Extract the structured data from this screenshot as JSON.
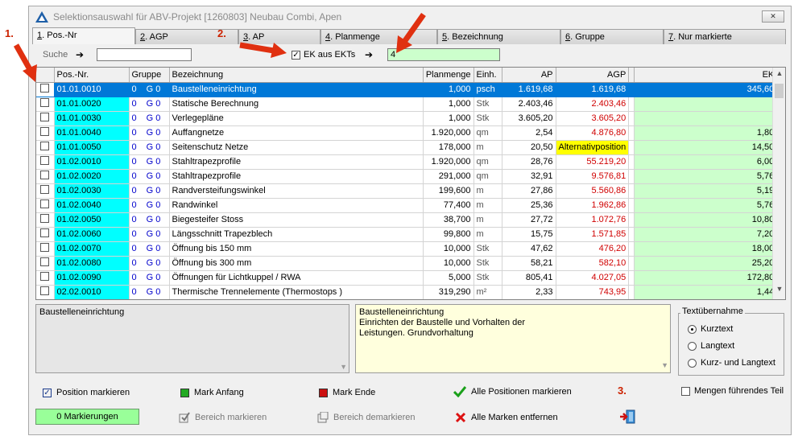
{
  "window": {
    "title": "Selektionsauswahl für ABV-Projekt [1260803] Neubau Combi, Apen",
    "close_symbol": "✕"
  },
  "tabs": [
    {
      "key": "1",
      "label": ". Pos.-Nr"
    },
    {
      "key": "2",
      "label": ". AGP"
    },
    {
      "key": "3",
      "label": ". AP"
    },
    {
      "key": "4",
      "label": ". Planmenge"
    },
    {
      "key": "5",
      "label": ". Bezeichnung"
    },
    {
      "key": "6",
      "label": ". Gruppe"
    },
    {
      "key": "7",
      "label": ". Nur markierte"
    }
  ],
  "search": {
    "label": "Suche",
    "arrow": "➔",
    "value": ""
  },
  "ek_filter": {
    "label": "EK aus EKTs",
    "checked": true,
    "arrow": "➔",
    "value": "4"
  },
  "columns": {
    "pos": "Pos.-Nr.",
    "group": "Gruppe",
    "name": "Bezeichnung",
    "qty": "Planmenge",
    "unit": "Einh.",
    "ap": "AP",
    "agp": "AGP",
    "ek": "EK"
  },
  "rows": [
    {
      "pos": "01.01.0010",
      "g1": "0",
      "g2": "G 0",
      "name": "Baustelleneinrichtung",
      "qty": "1,000",
      "unit": "psch",
      "ap": "1.619,68",
      "agp": "1.619,68",
      "ek": "345,60",
      "selected": true
    },
    {
      "pos": "01.01.0020",
      "g1": "0",
      "g2": "G 0",
      "name": "Statische Berechnung",
      "qty": "1,000",
      "unit": "Stk",
      "ap": "2.403,46",
      "agp": "2.403,46",
      "ek": ""
    },
    {
      "pos": "01.01.0030",
      "g1": "0",
      "g2": "G 0",
      "name": "Verlegepläne",
      "qty": "1,000",
      "unit": "Stk",
      "ap": "3.605,20",
      "agp": "3.605,20",
      "ek": ""
    },
    {
      "pos": "01.01.0040",
      "g1": "0",
      "g2": "G 0",
      "name": "Auffangnetze",
      "qty": "1.920,000",
      "unit": "qm",
      "ap": "2,54",
      "agp": "4.876,80",
      "ek": "1,80"
    },
    {
      "pos": "01.01.0050",
      "g1": "0",
      "g2": "G 0",
      "name": "Seitenschutz Netze",
      "qty": "178,000",
      "unit": "m",
      "ap": "20,50",
      "agp": "Alternativposition",
      "ek": "14,50",
      "alt": true
    },
    {
      "pos": "01.02.0010",
      "g1": "0",
      "g2": "G 0",
      "name": "Stahltrapezprofile",
      "qty": "1.920,000",
      "unit": "qm",
      "ap": "28,76",
      "agp": "55.219,20",
      "ek": "6,00"
    },
    {
      "pos": "01.02.0020",
      "g1": "0",
      "g2": "G 0",
      "name": "Stahltrapezprofile",
      "qty": "291,000",
      "unit": "qm",
      "ap": "32,91",
      "agp": "9.576,81",
      "ek": "5,76"
    },
    {
      "pos": "01.02.0030",
      "g1": "0",
      "g2": "G 0",
      "name": "Randversteifungswinkel",
      "qty": "199,600",
      "unit": "m",
      "ap": "27,86",
      "agp": "5.560,86",
      "ek": "5,19"
    },
    {
      "pos": "01.02.0040",
      "g1": "0",
      "g2": "G 0",
      "name": "Randwinkel",
      "qty": "77,400",
      "unit": "m",
      "ap": "25,36",
      "agp": "1.962,86",
      "ek": "5,76"
    },
    {
      "pos": "01.02.0050",
      "g1": "0",
      "g2": "G 0",
      "name": "Biegesteifer Stoss",
      "qty": "38,700",
      "unit": "m",
      "ap": "27,72",
      "agp": "1.072,76",
      "ek": "10,80"
    },
    {
      "pos": "01.02.0060",
      "g1": "0",
      "g2": "G 0",
      "name": "Längsschnitt Trapezblech",
      "qty": "99,800",
      "unit": "m",
      "ap": "15,75",
      "agp": "1.571,85",
      "ek": "7,20"
    },
    {
      "pos": "01.02.0070",
      "g1": "0",
      "g2": "G 0",
      "name": "Öffnung bis 150 mm",
      "qty": "10,000",
      "unit": "Stk",
      "ap": "47,62",
      "agp": "476,20",
      "ek": "18,00"
    },
    {
      "pos": "01.02.0080",
      "g1": "0",
      "g2": "G 0",
      "name": "Öffnung bis 300 mm",
      "qty": "10,000",
      "unit": "Stk",
      "ap": "58,21",
      "agp": "582,10",
      "ek": "25,20"
    },
    {
      "pos": "01.02.0090",
      "g1": "0",
      "g2": "G 0",
      "name": "Öffnungen für Lichtkuppel / RWA",
      "qty": "5,000",
      "unit": "Stk",
      "ap": "805,41",
      "agp": "4.027,05",
      "ek": "172,80"
    },
    {
      "pos": "02.02.0010",
      "g1": "0",
      "g2": "G 0",
      "name": "Thermische Trennelemente (Thermostops )",
      "qty": "319,290",
      "unit": "m²",
      "ap": "2,33",
      "agp": "743,95",
      "ek": "1,44"
    }
  ],
  "short_text": "Baustelleneinrichtung",
  "long_text": [
    "Baustelleneinrichtung",
    "Einrichten der Baustelle und Vorhalten der",
    "Leistungen. Grundvorhaltung"
  ],
  "text_transfer": {
    "title": "Textübernahme",
    "options": [
      "Kurztext",
      "Langtext",
      "Kurz- und Langtext"
    ],
    "selected": "Kurztext"
  },
  "quantities_option": "Mengen führendes Teil",
  "actions": {
    "mark_position": "Position markieren",
    "mark_start": "Mark Anfang",
    "mark_end": "Mark Ende",
    "mark_all": "Alle Positionen markieren",
    "mark_range": "Bereich markieren",
    "unmark_range": "Bereich demarkieren",
    "remove_all": "Alle Marken entfernen"
  },
  "mark_count": "0  Markierungen",
  "annotations": [
    "1.",
    "2.",
    "3."
  ],
  "colors": {
    "selection": "#0078d7",
    "pos_bg": "#00ffff",
    "ek_bg": "#ccffcc",
    "agp_red": "#d00000",
    "alt_yellow": "#ffff00",
    "arrow_red": "#e03010"
  }
}
